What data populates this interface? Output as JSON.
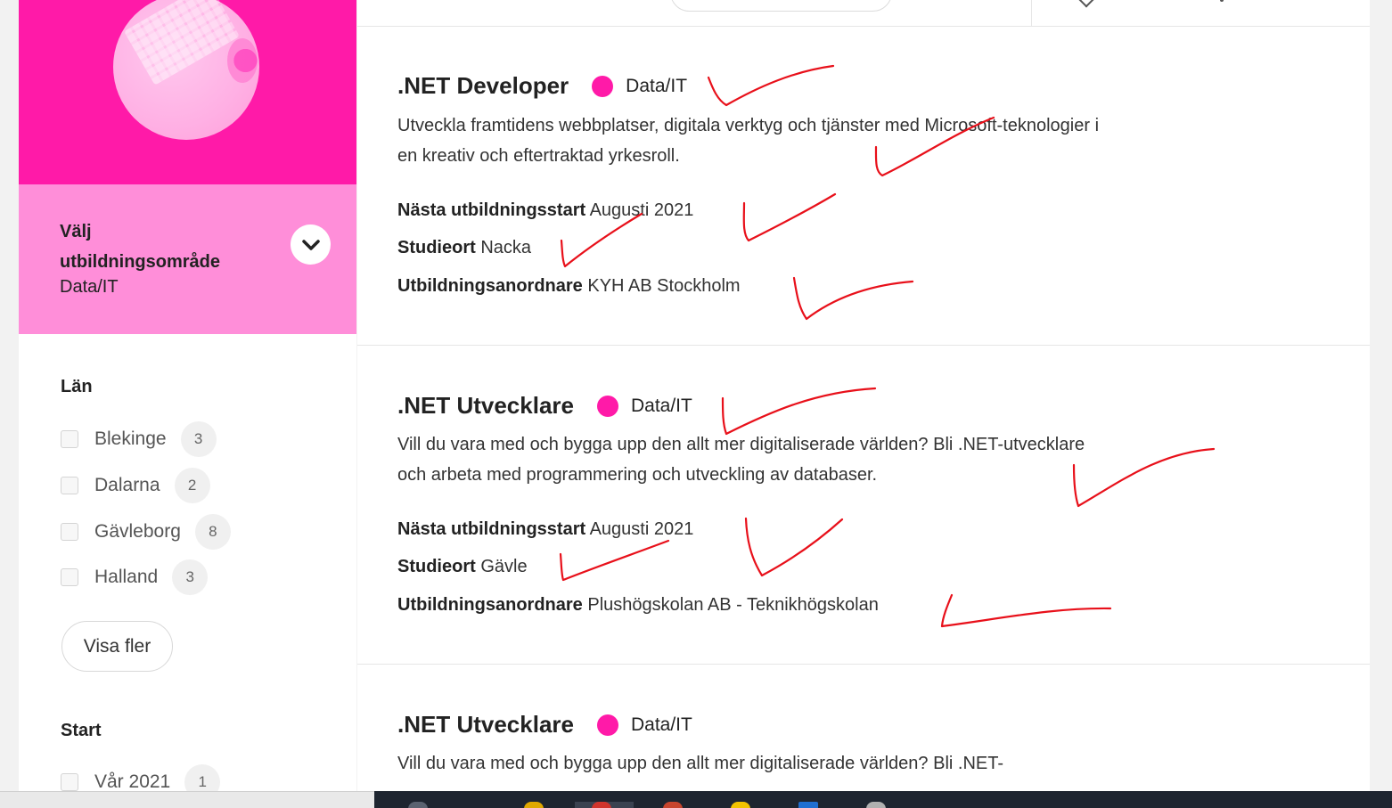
{
  "sidebar": {
    "area_label": "Välj utbildningsområde",
    "area_value": "Data/IT",
    "filters": [
      {
        "title": "Län",
        "items": [
          {
            "label": "Blekinge",
            "count": "3"
          },
          {
            "label": "Dalarna",
            "count": "2"
          },
          {
            "label": "Gävleborg",
            "count": "8"
          },
          {
            "label": "Halland",
            "count": "3"
          }
        ]
      },
      {
        "title": "Start",
        "items": [
          {
            "label": "Vår 2021",
            "count": "1"
          }
        ]
      }
    ],
    "show_more_label": "Visa fler"
  },
  "courses": [
    {
      "title": ".NET Developer",
      "category": "Data/IT",
      "description": "Utveckla framtidens webbplatser, digitala verktyg och tjänster med Microsoft-teknologier i en kreativ och eftertraktad yrkesroll.",
      "start_label": "Nästa utbildningsstart",
      "start_value": "Augusti 2021",
      "location_label": "Studieort",
      "location_value": "Nacka",
      "provider_label": "Utbildningsanordnare",
      "provider_value": "KYH AB Stockholm"
    },
    {
      "title": ".NET Utvecklare",
      "category": "Data/IT",
      "description": "Vill du vara med och bygga upp den allt mer digitaliserade världen? Bli .NET-utvecklare och arbeta med programmering och utveckling av databaser.",
      "start_label": "Nästa utbildningsstart",
      "start_value": "Augusti 2021",
      "location_label": "Studieort",
      "location_value": "Gävle",
      "provider_label": "Utbildningsanordnare",
      "provider_value": "Plushögskolan AB - Teknikhögskolan"
    },
    {
      "title": ".NET Utvecklare",
      "category": "Data/IT",
      "description": "Vill du vara med och bygga upp den allt mer digitaliserade världen? Bli .NET-"
    }
  ],
  "colors": {
    "brand_pink": "#ff1aa8",
    "light_pink": "#ff8ed9",
    "annotation_red": "#e8101a"
  },
  "icons": {
    "area_toggle": "chevron-down-icon"
  }
}
